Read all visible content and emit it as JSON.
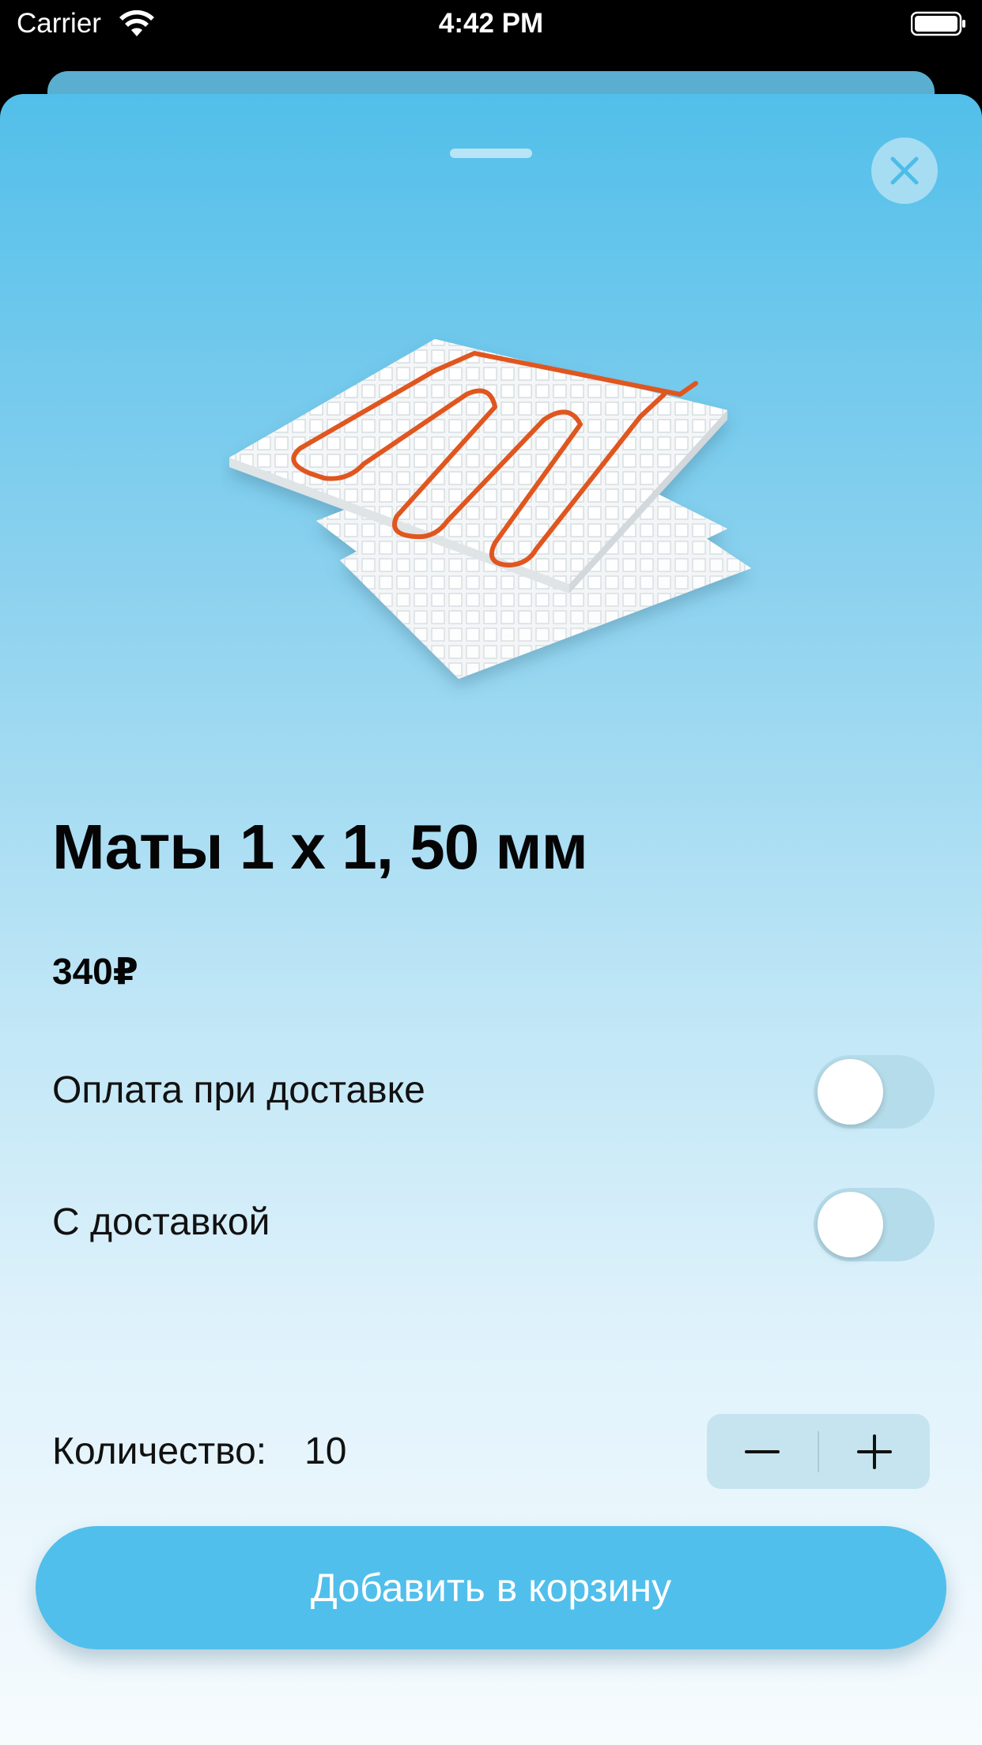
{
  "status_bar": {
    "carrier": "Carrier",
    "time": "4:42 PM",
    "wifi_icon": "wifi-icon",
    "battery_icon": "battery-full-icon"
  },
  "sheet": {
    "close_icon": "close-icon",
    "product_image": "heated-floor-mat-with-orange-cable"
  },
  "product": {
    "title": "Маты 1 х 1, 50 мм",
    "price": "340₽"
  },
  "options": {
    "cash_on_delivery": {
      "label": "Оплата при доставке",
      "enabled": false
    },
    "with_delivery": {
      "label": "С доставкой",
      "enabled": false
    }
  },
  "quantity": {
    "label": "Количество:",
    "value": "10",
    "decrement_icon": "minus-icon",
    "increment_icon": "plus-icon"
  },
  "cart": {
    "add_label": "Добавить в корзину"
  },
  "colors": {
    "accent": "#50bfec",
    "sheet_top": "#52bfea",
    "sheet_bottom": "#f6fbfe",
    "cable": "#e0561f"
  }
}
